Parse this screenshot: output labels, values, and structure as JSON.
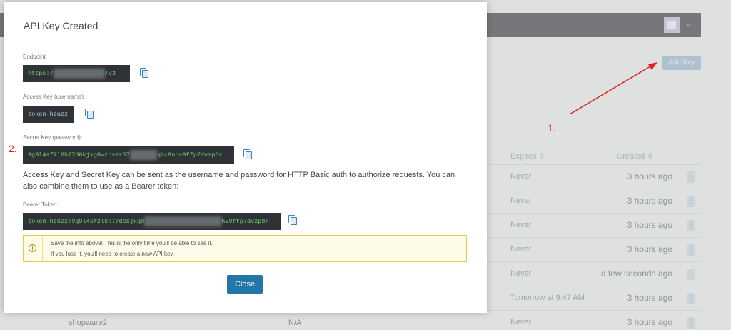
{
  "background": {
    "add_key_label": "Add Key",
    "columns": {
      "expires": "Expires",
      "created": "Created"
    },
    "sort_icon": "sort-icon",
    "rows": [
      {
        "expires": "Never",
        "created": "3 hours ago"
      },
      {
        "expires": "Never",
        "created": "3 hours ago"
      },
      {
        "expires": "Never",
        "created": "3 hours ago"
      },
      {
        "expires": "Never",
        "created": "3 hours ago"
      },
      {
        "expires": "Never",
        "created": "a few seconds ago"
      },
      {
        "expires": "Tomorrow at 9:47 AM",
        "created": "3 hours ago"
      },
      {
        "expires": "Never",
        "created": "3 hours ago"
      }
    ],
    "last_row_name": "shopware2",
    "last_row_na": "N/A"
  },
  "modal": {
    "title": "API Key Created",
    "endpoint_label": "Endpoint:",
    "endpoint_prefix": "https:/",
    "endpoint_suffix": "/v3",
    "access_key_label": "Access Key (username):",
    "access_key_value": "token-hzuzz",
    "secret_key_label": "Secret Key (password):",
    "secret_key_prefix": "9g9l4sf2l6b77d6kjxg8wrbvzr57",
    "secret_key_suffix": "qhc9nhv9ffp7dvzp8r",
    "info_text": "Access Key and Secret Key can be sent as the username and password for HTTP Basic auth to authorize requests. You can also combine them to use as a Bearer token:",
    "bearer_label": "Bearer Token:",
    "bearer_prefix": "token-hz62z:9g9l4sf2l6b77d6kjxg8",
    "bearer_suffix": "hv9ffp7dvzp8r",
    "warning_line1": "Save the info above! This is the only time you'll be able to see it.",
    "warning_line2": "If you lose it, you'll need to create a new API key.",
    "close_label": "Close"
  },
  "annotations": {
    "step1": "1.",
    "step2": "2."
  },
  "colors": {
    "accent": "#2276a8",
    "annotation": "#e0231e",
    "code_bg": "#2f3337",
    "code_text": "#6dd26d",
    "warning_border": "#e9c84a"
  }
}
